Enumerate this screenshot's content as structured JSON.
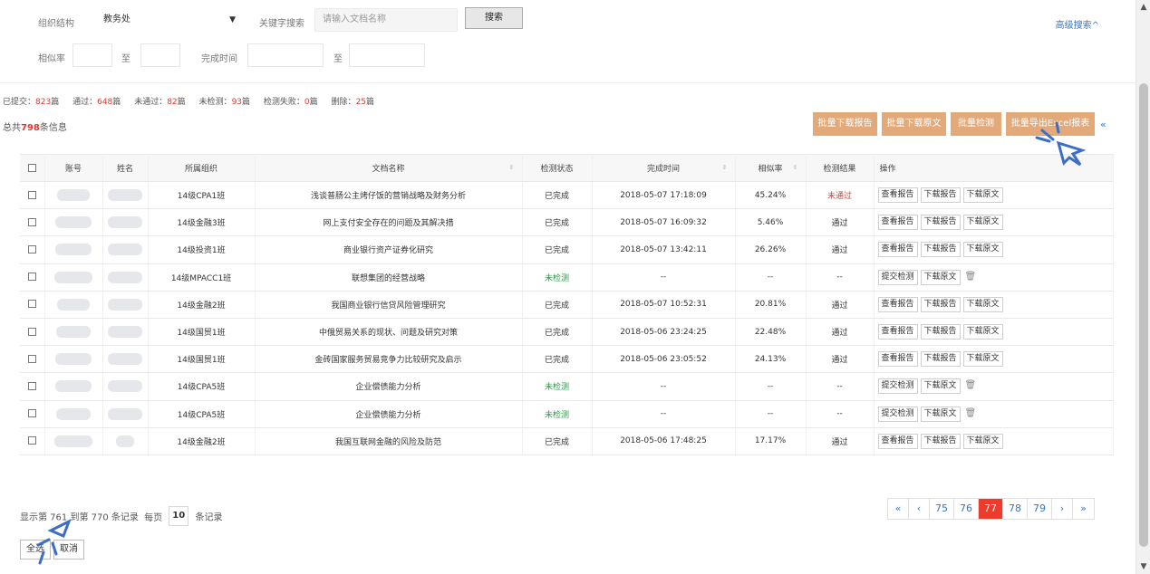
{
  "search": {
    "org_label": "组织结构",
    "org_value": "教务处",
    "keyword_label": "关键字搜索",
    "keyword_placeholder": "请输入文档名称",
    "search_button": "搜索",
    "advanced_link": "高级搜索^",
    "similarity_label": "相似率",
    "to_label": "至",
    "finish_time_label": "完成时间"
  },
  "stats": {
    "submitted_label": "已提交：",
    "submitted": "823",
    "unit": "篇",
    "passed_label": "通过：",
    "passed": "648",
    "failed_label": "未通过：",
    "failed": "82",
    "unchecked_label": "未检测：",
    "unchecked": "93",
    "check_failed_label": "检测失败：",
    "check_failed": "0",
    "deleted_label": "删除：",
    "deleted": "25"
  },
  "total": {
    "prefix": "总共",
    "count": "798",
    "suffix": "条信息"
  },
  "bulk_actions": [
    "批量下载报告",
    "批量下载原文",
    "批量检测",
    "批量导出Excel报表"
  ],
  "collapse_icon": "«",
  "table": {
    "headers": [
      "账号",
      "姓名",
      "所属组织",
      "文档名称",
      "检测状态",
      "完成时间",
      "相似率",
      "检测结果",
      "操作"
    ],
    "rows": [
      {
        "org": "14级CPA1班",
        "doc": "浅谈普肠公主烤仔饭的营销战略及财务分析",
        "status": "已完成",
        "time": "2018-05-07 17:18:09",
        "sim": "45.24%",
        "result": "未通过",
        "ops": [
          "查看报告",
          "下载报告",
          "下载原文"
        ]
      },
      {
        "org": "14级金融3班",
        "doc": "网上支付安全存在的问题及其解决措",
        "status": "已完成",
        "time": "2018-05-07 16:09:32",
        "sim": "5.46%",
        "result": "通过",
        "ops": [
          "查看报告",
          "下载报告",
          "下载原文"
        ]
      },
      {
        "org": "14级投资1班",
        "doc": "商业银行资产证券化研究",
        "status": "已完成",
        "time": "2018-05-07 13:42:11",
        "sim": "26.26%",
        "result": "通过",
        "ops": [
          "查看报告",
          "下载报告",
          "下载原文"
        ]
      },
      {
        "org": "14级MPACC1班",
        "doc": "联想集团的经营战略",
        "status": "未检测",
        "time": "--",
        "sim": "--",
        "result": "--",
        "ops": [
          "提交检测",
          "下载原文"
        ]
      },
      {
        "org": "14级金融2班",
        "doc": "我国商业银行信贷风险管理研究",
        "status": "已完成",
        "time": "2018-05-07 10:52:31",
        "sim": "20.81%",
        "result": "通过",
        "ops": [
          "查看报告",
          "下载报告",
          "下载原文"
        ]
      },
      {
        "org": "14级国贸1班",
        "doc": "中俄贸易关系的现状、问题及研究对策",
        "status": "已完成",
        "time": "2018-05-06 23:24:25",
        "sim": "22.48%",
        "result": "通过",
        "ops": [
          "查看报告",
          "下载报告",
          "下载原文"
        ]
      },
      {
        "org": "14级国贸1班",
        "doc": "金砖国家服务贸易竞争力比较研究及启示",
        "status": "已完成",
        "time": "2018-05-06 23:05:52",
        "sim": "24.13%",
        "result": "通过",
        "ops": [
          "查看报告",
          "下载报告",
          "下载原文"
        ]
      },
      {
        "org": "14级CPA5班",
        "doc": "企业偿债能力分析",
        "status": "未检测",
        "time": "--",
        "sim": "--",
        "result": "--",
        "ops": [
          "提交检测",
          "下载原文"
        ]
      },
      {
        "org": "14级CPA5班",
        "doc": "企业偿债能力分析",
        "status": "未检测",
        "time": "--",
        "sim": "--",
        "result": "--",
        "ops": [
          "提交检测",
          "下载原文"
        ]
      },
      {
        "org": "14级金融2班",
        "doc": "我国互联网金融的风险及防范",
        "status": "已完成",
        "time": "2018-05-06 17:48:25",
        "sim": "17.17%",
        "result": "通过",
        "ops": [
          "查看报告",
          "下载报告",
          "下载原文"
        ]
      }
    ]
  },
  "pager": {
    "info_prefix": "显示第 761 到第 770 条记录",
    "per_page_label": "每页",
    "per_page": "10",
    "per_page_suffix": "条记录",
    "pages": [
      "«",
      "‹",
      "75",
      "76",
      "77",
      "78",
      "79",
      "›",
      "»"
    ],
    "active_page": "77"
  },
  "footer_buttons": {
    "select_all": "全选",
    "cancel": "取消"
  },
  "colors": {
    "accent_orange": "#e3a979",
    "active_red": "#ef3b2c",
    "link_blue": "#3a73c4",
    "pass_green": "#2a9a4a",
    "fail_red": "#e4382c"
  }
}
